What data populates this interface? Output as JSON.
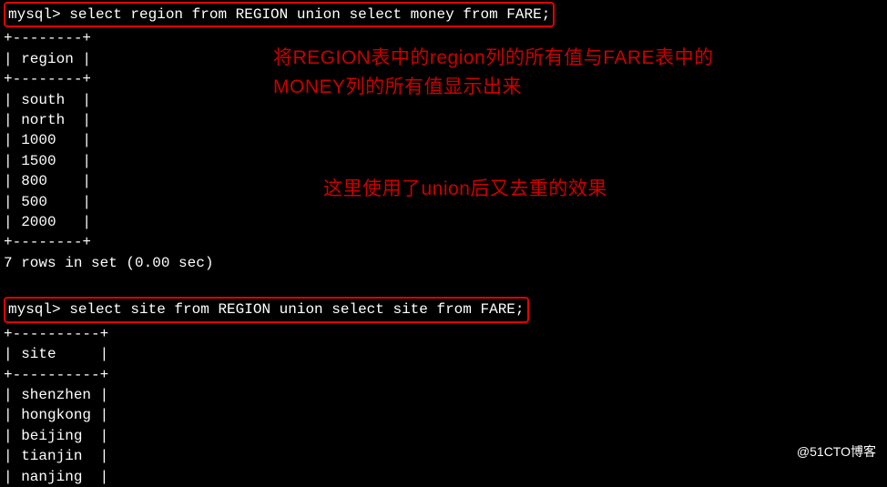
{
  "query1": {
    "prompt": "mysql> select region from REGION union select money from FARE;",
    "sep": "+--------+",
    "header": "| region |",
    "rows": [
      "| south  |",
      "| north  |",
      "| 1000   |",
      "| 1500   |",
      "| 800    |",
      "| 500    |",
      "| 2000   |"
    ],
    "summary": "7 rows in set (0.00 sec)"
  },
  "annotation1_line1": "将REGION表中的region列的所有值与FARE表中的",
  "annotation1_line2": "MONEY列的所有值显示出来",
  "annotation2": "这里使用了union后又去重的效果",
  "query2": {
    "prompt": "mysql> select site from REGION union select site from FARE;",
    "sep": "+----------+",
    "header": "| site     |",
    "rows": [
      "| shenzhen |",
      "| hongkong |",
      "| beijing  |",
      "| tianjin  |",
      "| nanjing  |"
    ]
  },
  "watermark": "@51CTO博客",
  "chart_data": {
    "type": "table",
    "queries": [
      {
        "sql": "select region from REGION union select money from FARE;",
        "column": "region",
        "values": [
          "south",
          "north",
          1000,
          1500,
          800,
          500,
          2000
        ],
        "row_count": 7,
        "elapsed_sec": 0.0
      },
      {
        "sql": "select site from REGION union select site from FARE;",
        "column": "site",
        "values": [
          "shenzhen",
          "hongkong",
          "beijing",
          "tianjin",
          "nanjing"
        ]
      }
    ]
  }
}
